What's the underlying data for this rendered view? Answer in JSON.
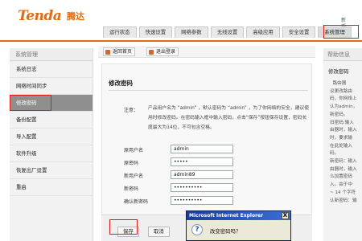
{
  "header": {
    "logo_text": "Tenda",
    "logo_cn": "腾达",
    "top_links": [
      "新",
      "帮"
    ],
    "tabs": [
      "运行状态",
      "快速设置",
      "网络参数",
      "无线设置",
      "高级应用",
      "安全设置",
      "系统管理"
    ]
  },
  "sidebar": {
    "title": "系统管理",
    "items": [
      "系统日志",
      "网络时间同步",
      "修改密码",
      "备份配置",
      "导入配置",
      "软件升级",
      "恢复出厂设置",
      "重启"
    ]
  },
  "toolbar": {
    "home_label": "返回首页",
    "logout_label": "退出登录"
  },
  "form": {
    "section_title": "修改密码",
    "note_label": "注意：",
    "note_text": "产品用户名为 “admin” ，默认密码为 “admin” ，为了你网络的安全，建议使用时修改密码。在密码输入框中输入密码，点击“保存”按钮保存设置，密码长度最大为14位，不可包含空格。",
    "fields": [
      {
        "label": "原用户名",
        "value": "admin"
      },
      {
        "label": "原密码",
        "value": "•••••"
      },
      {
        "label": "新用户名",
        "value": "admin89"
      },
      {
        "label": "新密码",
        "value": "••••••••••"
      },
      {
        "label": "确认新密码",
        "value": "••••••••••"
      }
    ],
    "save_label": "保存",
    "cancel_label": "取消"
  },
  "help": {
    "title": "帮助信息",
    "subtitle": "修改密码",
    "text": "  路由器\n议更改路由\n码，你网络上\n认为admin，\n新密码。\n旧密码:输入\n由器时，输入\n时，要求输\n在此处输入\n码。\n新密码：输入\n由器时，输入\n么加置密码\n入。由于中\n~ 14 个字符\n认新密码：输"
  },
  "dialog": {
    "title": "Microsoft Internet Explorer",
    "close_label": "X",
    "icon_glyph": "?",
    "message": "改变密码吗？"
  }
}
